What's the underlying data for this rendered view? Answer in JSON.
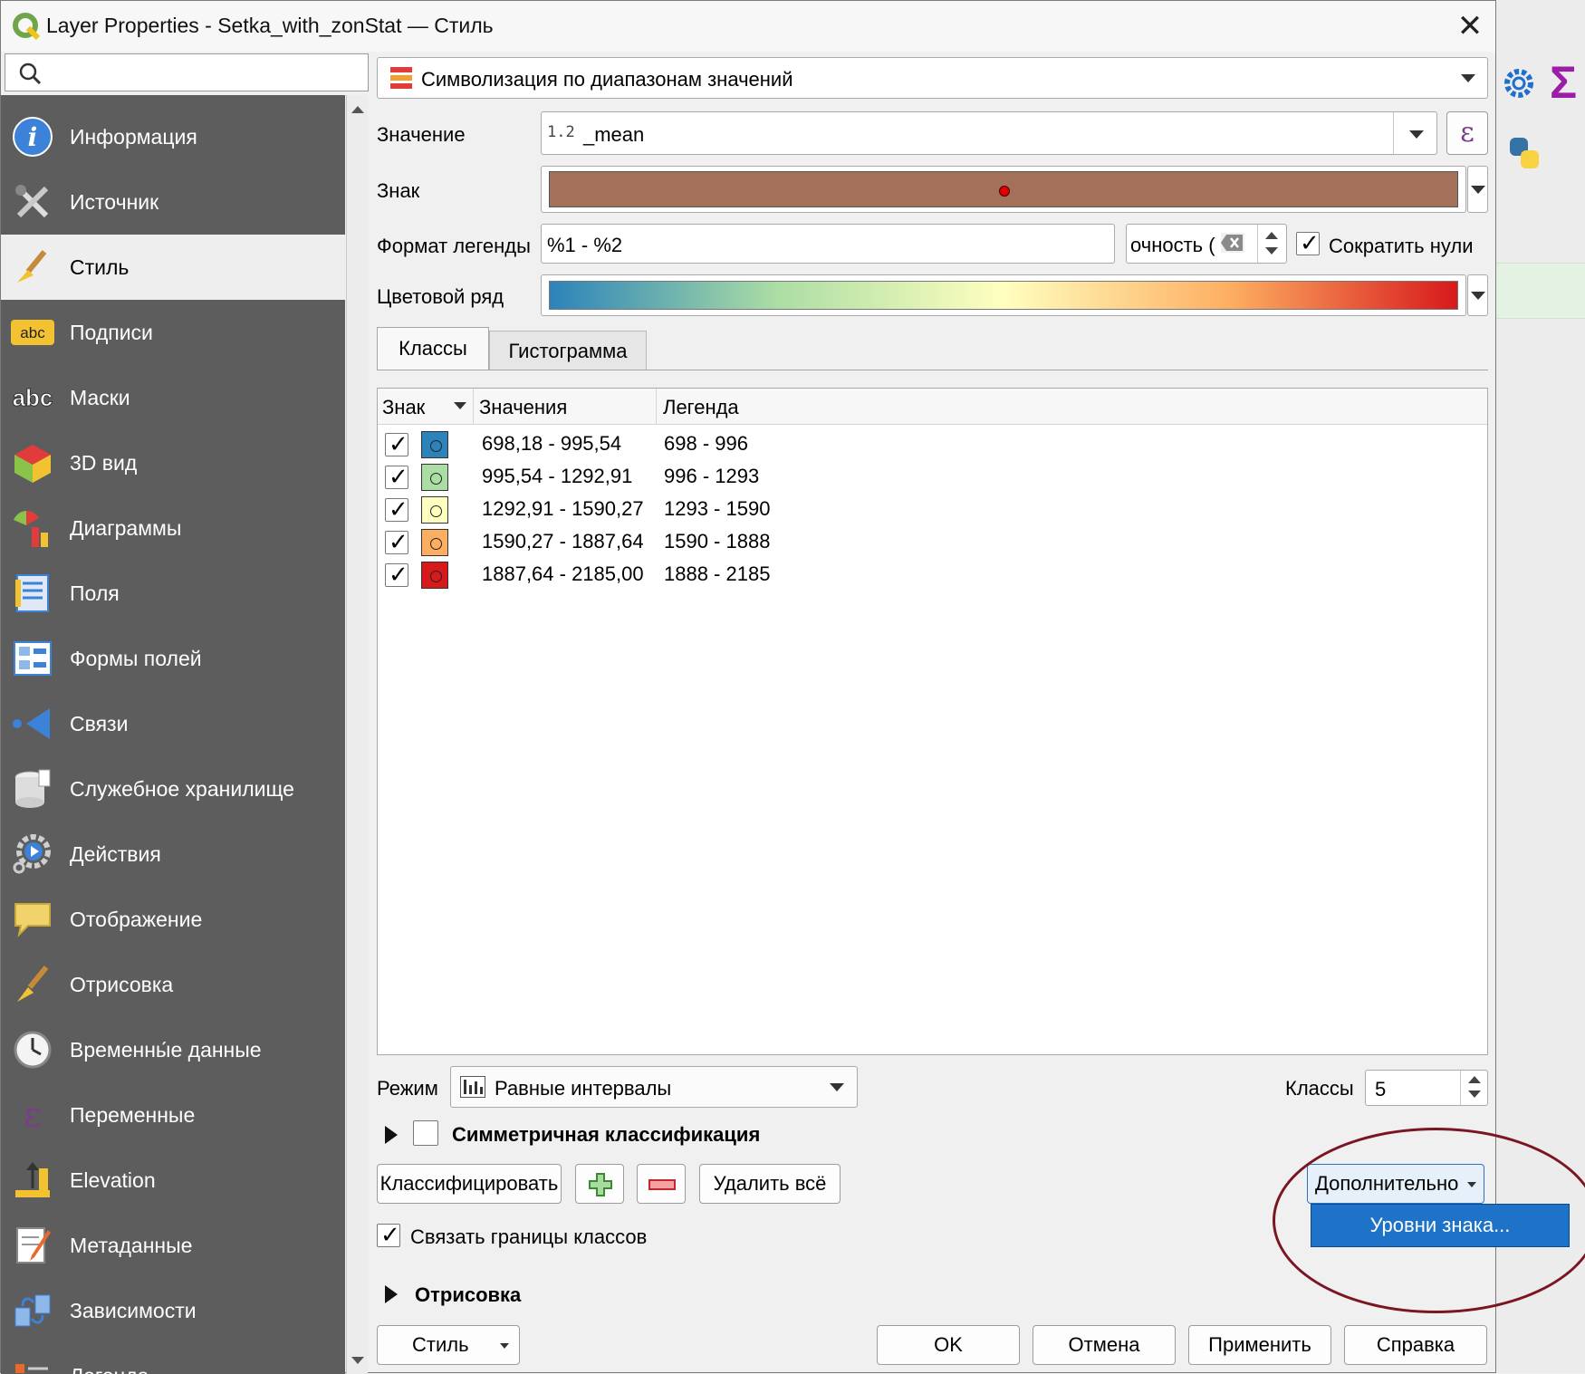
{
  "window": {
    "title": "Layer Properties - Setka_with_zonStat — Стиль",
    "close_icon": "close-icon"
  },
  "sidebar": {
    "search_placeholder": "",
    "items": [
      {
        "label": "Информация",
        "icon": "info-icon"
      },
      {
        "label": "Источник",
        "icon": "source-icon"
      },
      {
        "label": "Стиль",
        "icon": "paintbrush-icon",
        "active": true
      },
      {
        "label": "Подписи",
        "icon": "labels-abc-icon"
      },
      {
        "label": "Маски",
        "icon": "masks-abc-icon"
      },
      {
        "label": "3D вид",
        "icon": "3d-cube-icon"
      },
      {
        "label": "Диаграммы",
        "icon": "diagrams-icon"
      },
      {
        "label": "Поля",
        "icon": "fields-icon"
      },
      {
        "label": "Формы полей",
        "icon": "attribute-form-icon"
      },
      {
        "label": "Связи",
        "icon": "joins-icon"
      },
      {
        "label": "Служебное хранилище",
        "icon": "auxiliary-storage-icon"
      },
      {
        "label": "Действия",
        "icon": "actions-icon"
      },
      {
        "label": "Отображение",
        "icon": "display-tooltip-icon"
      },
      {
        "label": "Отрисовка",
        "icon": "rendering-brush-icon"
      },
      {
        "label": "Временны́е данные",
        "icon": "clock-icon"
      },
      {
        "label": "Переменные",
        "icon": "epsilon-icon"
      },
      {
        "label": "Elevation",
        "icon": "elevation-icon"
      },
      {
        "label": "Метаданные",
        "icon": "metadata-icon"
      },
      {
        "label": "Зависимости",
        "icon": "dependencies-icon"
      },
      {
        "label": "Легенда",
        "icon": "legend-icon"
      }
    ]
  },
  "renderer": {
    "type_label": "Символизация по диапазонам значений",
    "value_label": "Значение",
    "value_field_type": "1.2",
    "value_field": "_mean",
    "symbol_label": "Знак",
    "symbol_color": "#a3705a",
    "legend_format_label": "Формат легенды",
    "legend_format": "%1 - %2",
    "precision_text": "очность (",
    "trim_zeros_label": "Сократить нули",
    "trim_zeros_checked": true,
    "color_ramp_label": "Цветовой ряд",
    "ramp_colors": [
      "#2b83ba",
      "#abdda4",
      "#ffffbf",
      "#fdae61",
      "#d7191c"
    ]
  },
  "tabs": [
    {
      "label": "Классы",
      "active": true
    },
    {
      "label": "Гистограмма",
      "active": false
    }
  ],
  "table": {
    "headers": [
      "Знак",
      "Значения",
      "Легенда"
    ],
    "rows": [
      {
        "checked": true,
        "color": "#2b83ba",
        "values": "698,18 - 995,54",
        "legend": "698 - 996"
      },
      {
        "checked": true,
        "color": "#abdda4",
        "values": "995,54 - 1292,91",
        "legend": "996 - 1293"
      },
      {
        "checked": true,
        "color": "#ffffbf",
        "values": "1292,91 - 1590,27",
        "legend": "1293 - 1590"
      },
      {
        "checked": true,
        "color": "#fdae61",
        "values": "1590,27 - 1887,64",
        "legend": "1590 - 1888"
      },
      {
        "checked": true,
        "color": "#d7191c",
        "values": "1887,64 - 2185,00",
        "legend": "1888 - 2185"
      }
    ]
  },
  "mode": {
    "label": "Режим",
    "value": "Равные интервалы",
    "classes_label": "Классы",
    "classes_value": "5"
  },
  "symmetric": {
    "label": "Симметричная классификация",
    "checked": false
  },
  "actions": {
    "classify": "Классифицировать",
    "delete_all": "Удалить всё",
    "advanced": "Дополнительно",
    "advanced_menu_item": "Уровни знака..."
  },
  "link_bounds": {
    "label": "Связать границы классов",
    "checked": true
  },
  "rendering_section": "Отрисовка",
  "footer": {
    "style": "Стиль",
    "ok": "OK",
    "cancel": "Отмена",
    "apply": "Применить",
    "help": "Справка"
  }
}
